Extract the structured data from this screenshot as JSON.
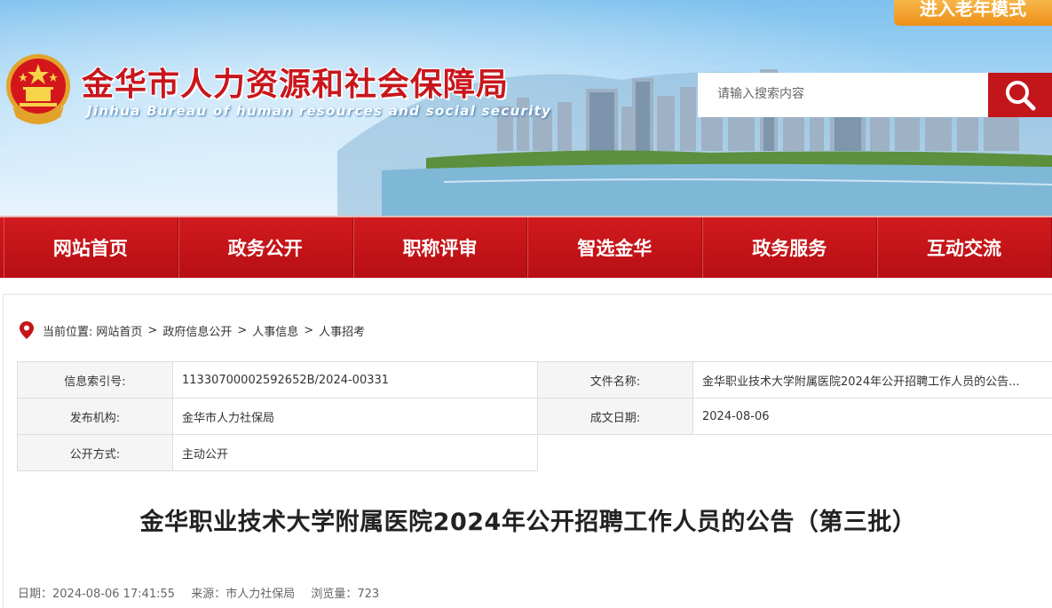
{
  "header": {
    "elder_mode": "进入老年模式",
    "title_cn": "金华市人力资源和社会保障局",
    "title_en": "Jinhua Bureau of human resources and social security",
    "search_placeholder": "请输入搜索内容"
  },
  "nav": {
    "items": [
      {
        "label": "网站首页"
      },
      {
        "label": "政务公开"
      },
      {
        "label": "职称评审"
      },
      {
        "label": "智选金华"
      },
      {
        "label": "政务服务"
      },
      {
        "label": "互动交流"
      }
    ]
  },
  "breadcrumb": {
    "prefix": "当前位置:",
    "items": [
      "网站首页",
      "政府信息公开",
      "人事信息",
      "人事招考"
    ],
    "separator": ">"
  },
  "meta": {
    "index_label": "信息索引号:",
    "index_value": "11330700002592652B/2024-00331",
    "file_label": "文件名称:",
    "file_value": "金华职业技术大学附属医院2024年公开招聘工作人员的公告...",
    "org_label": "发布机构:",
    "org_value": "金华市人力社保局",
    "date_label": "成文日期:",
    "date_value": "2024-08-06",
    "mode_label": "公开方式:",
    "mode_value": "主动公开"
  },
  "article": {
    "title": "金华职业技术大学附属医院2024年公开招聘工作人员的公告（第三批）",
    "date": "日期：2024-08-06 17:41:55",
    "source": "来源：市人力社保局",
    "views": "浏览量：723"
  },
  "colors": {
    "brand_red": "#c3161b",
    "elder_orange": "#ee8f17"
  }
}
